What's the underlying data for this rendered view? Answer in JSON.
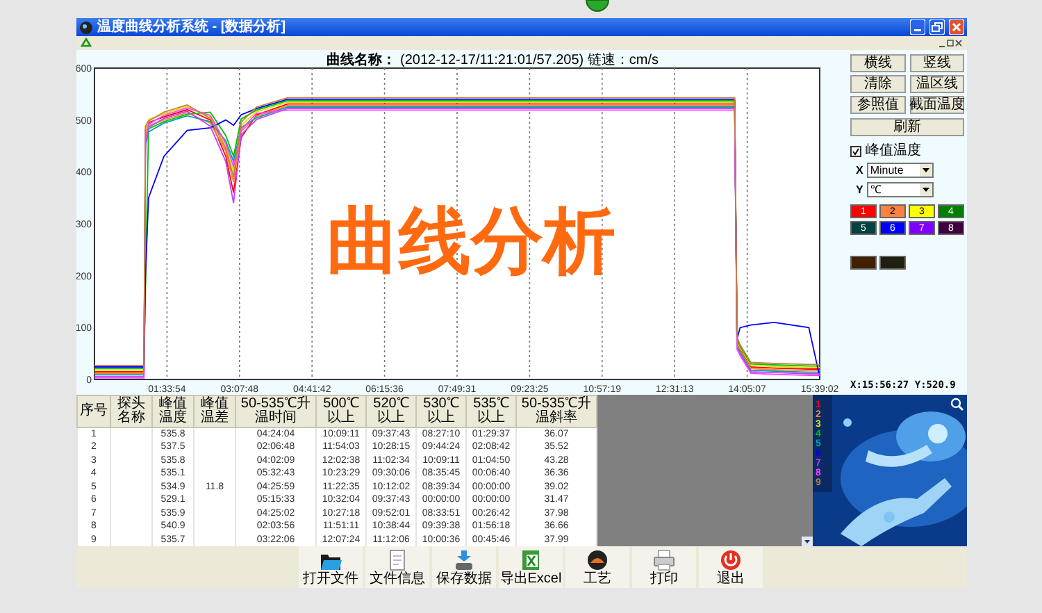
{
  "window": {
    "title": "温度曲线分析系统 - [数据分析]"
  },
  "chart_header": {
    "label": "曲线名称：",
    "value": "(2012-12-17/11:21:01/57.205) 链速：cm/s"
  },
  "overlay_caption": "曲线分析",
  "chart_data": {
    "type": "line",
    "grid": true,
    "xlim": [
      0,
      939.033
    ],
    "ylim": [
      0,
      600
    ],
    "yticks": [
      0,
      100,
      200,
      300,
      400,
      500,
      600
    ],
    "xticks": [
      {
        "value": 93.9,
        "label": "01:33:54"
      },
      {
        "value": 187.8,
        "label": "03:07:48"
      },
      {
        "value": 281.7,
        "label": "04:41:42"
      },
      {
        "value": 375.6,
        "label": "06:15:36"
      },
      {
        "value": 469.517,
        "label": "07:49:31"
      },
      {
        "value": 563.417,
        "label": "09:23:25"
      },
      {
        "value": 657.317,
        "label": "10:57:19"
      },
      {
        "value": 751.217,
        "label": "12:31:13"
      },
      {
        "value": 845.117,
        "label": "14:05:07"
      },
      {
        "value": 939.033,
        "label": "15:39:02"
      }
    ],
    "x": [
      0,
      40,
      64,
      66,
      70,
      90,
      120,
      150,
      170,
      180,
      190,
      210,
      250,
      400,
      600,
      829,
      832,
      836,
      850,
      880,
      925,
      939
    ],
    "series": [
      {
        "name": "1",
        "color": "#ff0000",
        "values": [
          15,
          15,
          15,
          482,
          495,
          506,
          520,
          500,
          430,
          360,
          466,
          510,
          531,
          531,
          531,
          531,
          70,
          58,
          24,
          22,
          20,
          20
        ]
      },
      {
        "name": "2",
        "color": "#ff8040",
        "values": [
          12,
          12,
          12,
          470,
          489,
          500,
          514,
          494,
          440,
          380,
          478,
          507,
          528,
          528,
          528,
          528,
          67,
          55,
          21,
          19,
          17,
          17
        ]
      },
      {
        "name": "3",
        "color": "#e0e000",
        "values": [
          18,
          18,
          18,
          476,
          501,
          512,
          526,
          506,
          450,
          400,
          490,
          516,
          534,
          534,
          534,
          534,
          73,
          61,
          27,
          25,
          23,
          23
        ]
      },
      {
        "name": "4",
        "color": "#00c000",
        "values": [
          21,
          21,
          21,
          null,
          483,
          497,
          511,
          515,
          470,
          430,
          502,
          519,
          537,
          537,
          537,
          537,
          76,
          64,
          30,
          28,
          26,
          26
        ]
      },
      {
        "name": "5",
        "color": "#00a0a0",
        "values": [
          9,
          9,
          9,
          450,
          477,
          494,
          508,
          497,
          460,
          420,
          486,
          504,
          525,
          525,
          525,
          525,
          64,
          52,
          18,
          16,
          14,
          14
        ]
      },
      {
        "name": "6",
        "color": "#0000ff",
        "values": [
          24,
          24,
          24,
          200,
          350,
          430,
          480,
          485,
          500,
          490,
          510,
          522,
          540,
          540,
          540,
          540,
          79,
          100,
          105,
          110,
          100,
          5
        ]
      },
      {
        "name": "7",
        "color": "#c040ff",
        "values": [
          6,
          6,
          6,
          454,
          486,
          503,
          517,
          488,
          420,
          340,
          472,
          501,
          522,
          522,
          522,
          522,
          61,
          49,
          15,
          13,
          11,
          11
        ]
      },
      {
        "name": "8",
        "color": "#ff40ff",
        "values": [
          3,
          3,
          3,
          464,
          492,
          509,
          523,
          509,
          455,
          410,
          482,
          513,
          519,
          519,
          519,
          519,
          58,
          46,
          12,
          10,
          8,
          8
        ]
      },
      {
        "name": "9",
        "color": "#c08040",
        "values": [
          27,
          27,
          27,
          488,
          498,
          515,
          529,
          503,
          445,
          390,
          496,
          525,
          543,
          543,
          543,
          543,
          82,
          67,
          33,
          31,
          29,
          29
        ]
      }
    ]
  },
  "readout": "X:15:56:27 Y:520.9",
  "panel_buttons": [
    "横线",
    "竖线",
    "清除",
    "温区线",
    "参照值",
    "截面温度"
  ],
  "refresh_button": "刷新",
  "peak_checkbox": {
    "label": "峰值温度",
    "checked": true
  },
  "x_select": {
    "label": "X",
    "value": "Minute"
  },
  "y_select": {
    "label": "Y",
    "value": "℃"
  },
  "swatches": [
    {
      "label": "1",
      "color": "#ff0000"
    },
    {
      "label": "2",
      "color": "#ff8040"
    },
    {
      "label": "3",
      "color": "#ffff00"
    },
    {
      "label": "4",
      "color": "#008000"
    },
    {
      "label": "5",
      "color": "#004040"
    },
    {
      "label": "6",
      "color": "#0000ff"
    },
    {
      "label": "7",
      "color": "#8000ff"
    },
    {
      "label": "8",
      "color": "#400040"
    }
  ],
  "extra_swatches": [
    {
      "color": "#402000"
    },
    {
      "color": "#202010"
    }
  ],
  "table": {
    "columns": [
      "序号",
      "探头名称",
      "峰值温度",
      "峰值温差",
      "50-535℃升温时间",
      "500℃以上",
      "520℃以上",
      "530℃以上",
      "535℃以上",
      "50-535℃升温斜率"
    ],
    "rows": [
      [
        "1",
        "",
        "535.8",
        "",
        "04:24:04",
        "10:09:11",
        "09:37:43",
        "08:27:10",
        "01:29:37",
        "36.07"
      ],
      [
        "2",
        "",
        "537.5",
        "",
        "02:06:48",
        "11:54:03",
        "10:28:15",
        "09:44:24",
        "02:08:42",
        "35.52"
      ],
      [
        "3",
        "",
        "535.8",
        "",
        "04:02:09",
        "12:02:38",
        "11:02:34",
        "10:09:11",
        "01:04:50",
        "43.28"
      ],
      [
        "4",
        "",
        "535.1",
        "",
        "05:32:43",
        "10:23:29",
        "09:30:06",
        "08:35:45",
        "00:06:40",
        "36.36"
      ],
      [
        "5",
        "",
        "534.9",
        "11.8",
        "04:25:59",
        "11:22:35",
        "10:12:02",
        "08:39:34",
        "00:00:00",
        "39.02"
      ],
      [
        "6",
        "",
        "529.1",
        "",
        "05:15:33",
        "10:32:04",
        "09:37:43",
        "00:00:00",
        "00:00:00",
        "31.47"
      ],
      [
        "7",
        "",
        "535.9",
        "",
        "04:25:02",
        "10:27:18",
        "09:52:01",
        "08:33:51",
        "00:26:42",
        "37.98"
      ],
      [
        "8",
        "",
        "540.9",
        "",
        "02:03:56",
        "11:51:11",
        "10:38:44",
        "09:39:38",
        "01:56:18",
        "36.66"
      ],
      [
        "9",
        "",
        "535.7",
        "",
        "03:22:06",
        "12:07:24",
        "11:12:06",
        "10:00:36",
        "00:45:46",
        "37.99"
      ]
    ]
  },
  "toolbar": [
    "打开文件",
    "文件信息",
    "保存数据",
    "导出Excel",
    "工艺",
    "打印",
    "退出"
  ]
}
